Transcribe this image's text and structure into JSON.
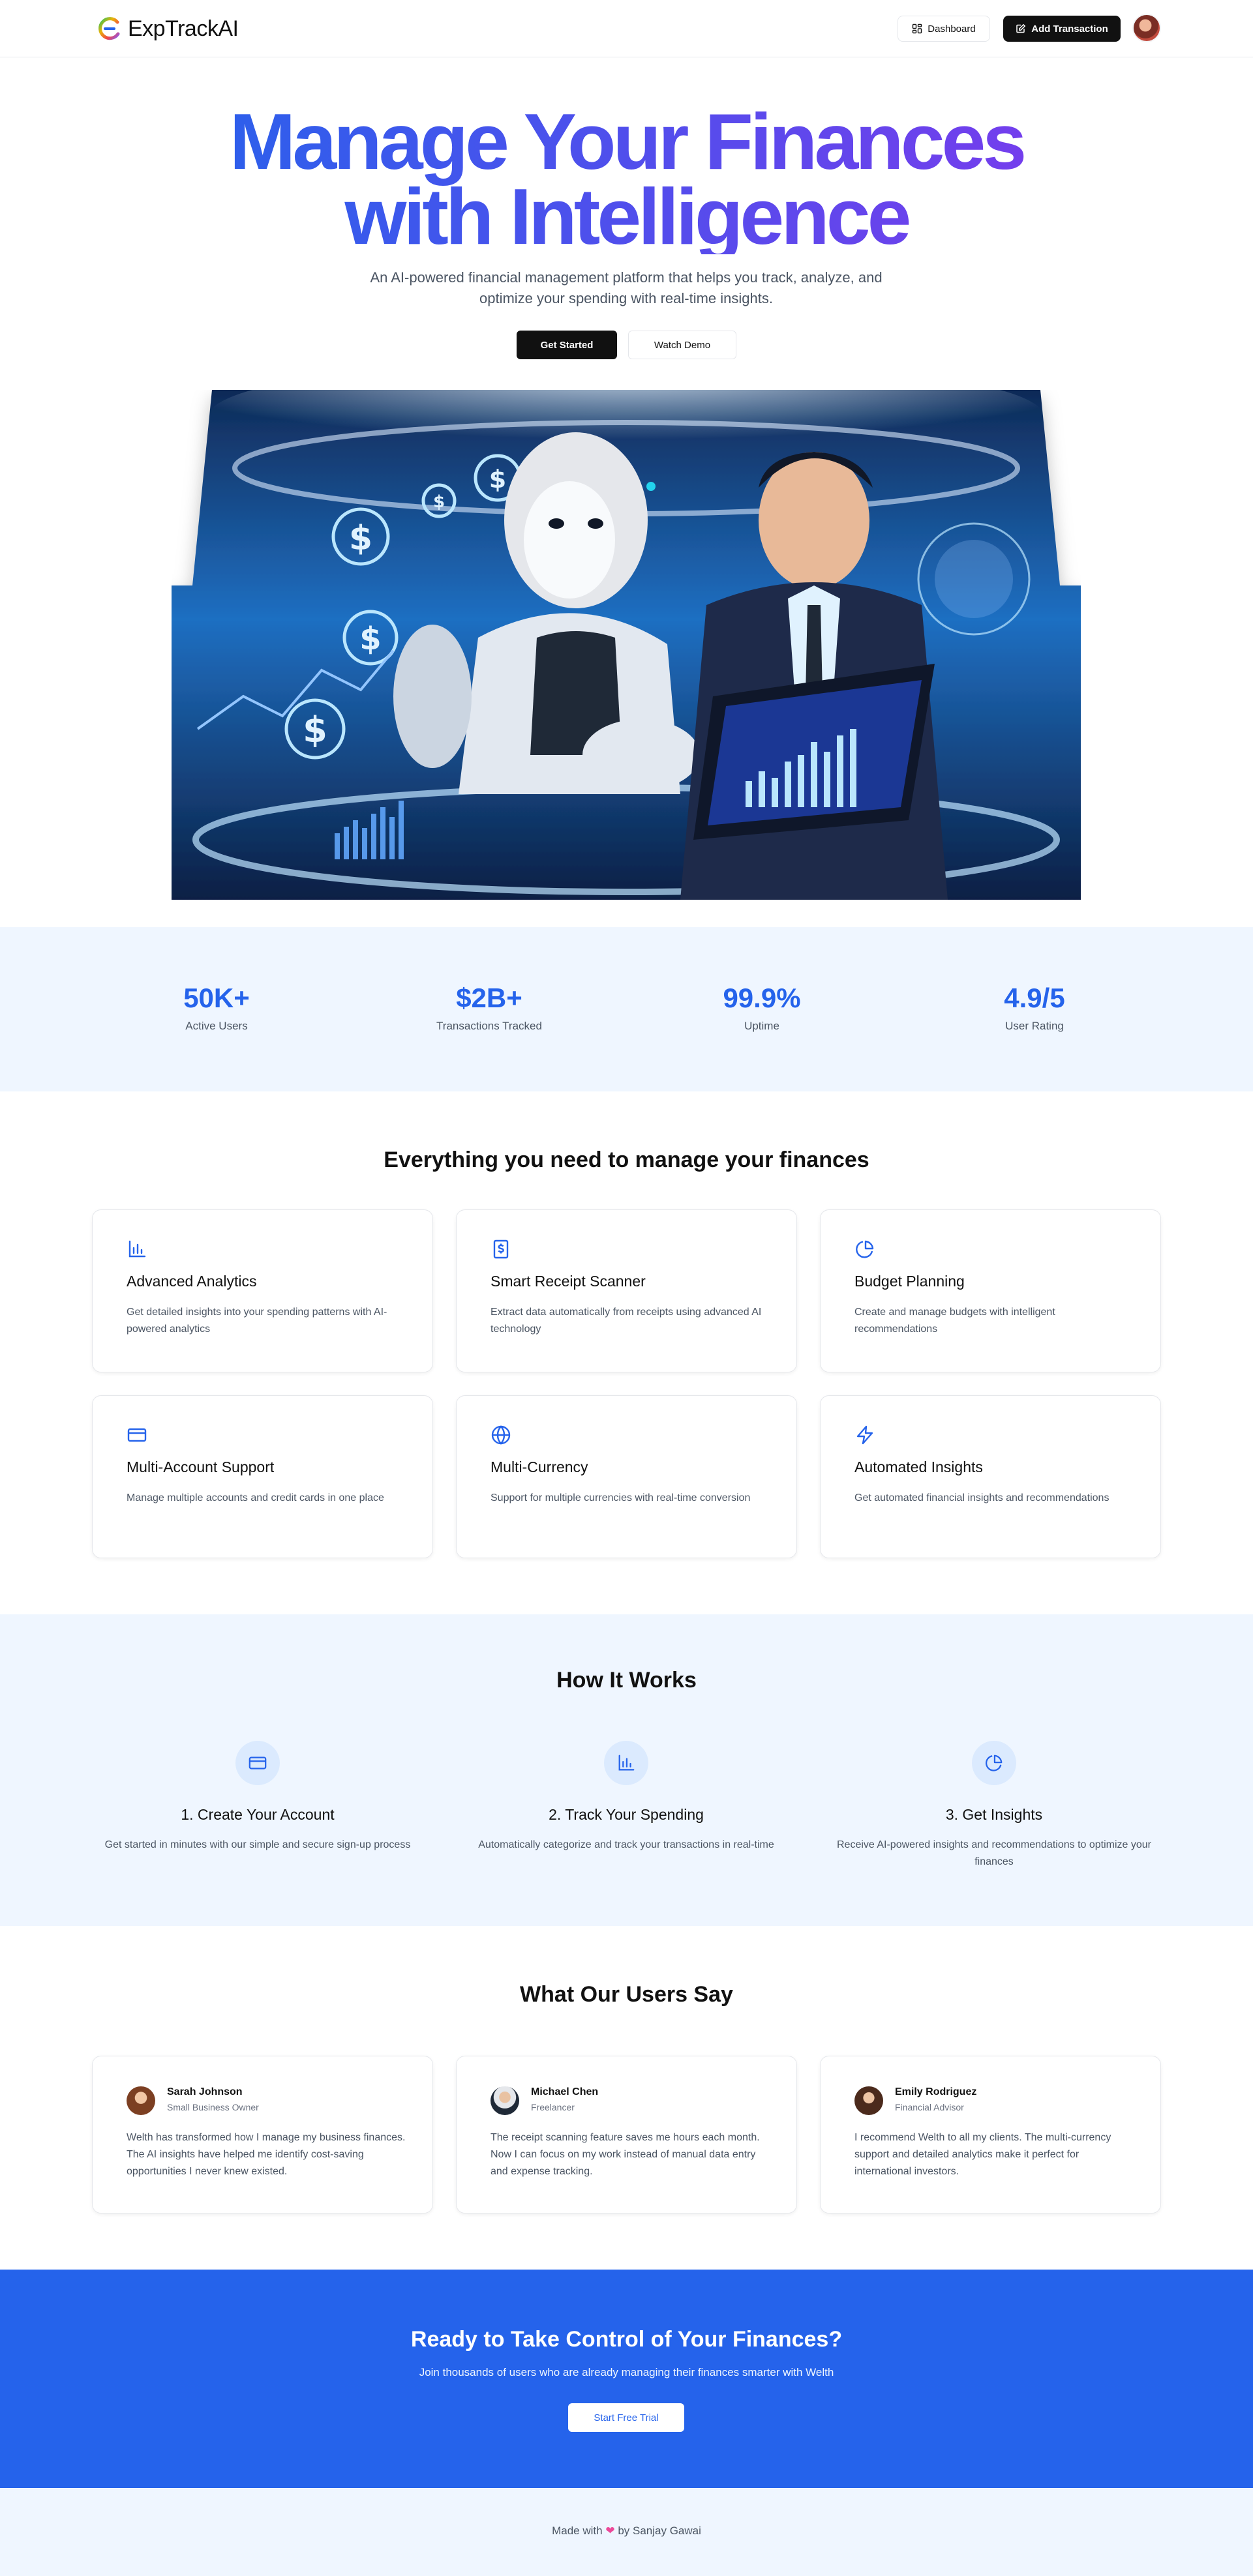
{
  "header": {
    "brand": "ExpTrackAI",
    "dashboard_label": "Dashboard",
    "add_transaction_label": "Add Transaction"
  },
  "hero": {
    "title_line1": "Manage Your Finances",
    "title_line2": "with Intelligence",
    "subtitle": "An AI-powered financial management platform that helps you track, analyze, and optimize your spending with real-time insights.",
    "primary_cta": "Get Started",
    "secondary_cta": "Watch Demo",
    "colors": {
      "gradient_start": "#2563eb",
      "gradient_end": "#7c3aed"
    }
  },
  "stats": [
    {
      "value": "50K+",
      "label": "Active Users"
    },
    {
      "value": "$2B+",
      "label": "Transactions Tracked"
    },
    {
      "value": "99.9%",
      "label": "Uptime"
    },
    {
      "value": "4.9/5",
      "label": "User Rating"
    }
  ],
  "features": {
    "title": "Everything you need to manage your finances",
    "items": [
      {
        "icon": "bar-chart-icon",
        "title": "Advanced Analytics",
        "description": "Get detailed insights into your spending patterns with AI-powered analytics"
      },
      {
        "icon": "receipt-icon",
        "title": "Smart Receipt Scanner",
        "description": "Extract data automatically from receipts using advanced AI technology"
      },
      {
        "icon": "pie-chart-icon",
        "title": "Budget Planning",
        "description": "Create and manage budgets with intelligent recommendations"
      },
      {
        "icon": "credit-card-icon",
        "title": "Multi-Account Support",
        "description": "Manage multiple accounts and credit cards in one place"
      },
      {
        "icon": "globe-icon",
        "title": "Multi-Currency",
        "description": "Support for multiple currencies with real-time conversion"
      },
      {
        "icon": "zap-icon",
        "title": "Automated Insights",
        "description": "Get automated financial insights and recommendations"
      }
    ]
  },
  "how_it_works": {
    "title": "How It Works",
    "steps": [
      {
        "icon": "credit-card-icon",
        "title": "1. Create Your Account",
        "description": "Get started in minutes with our simple and secure sign-up process"
      },
      {
        "icon": "bar-chart-icon",
        "title": "2. Track Your Spending",
        "description": "Automatically categorize and track your transactions in real-time"
      },
      {
        "icon": "pie-chart-icon",
        "title": "3. Get Insights",
        "description": "Receive AI-powered insights and recommendations to optimize your finances"
      }
    ]
  },
  "testimonials": {
    "title": "What Our Users Say",
    "items": [
      {
        "name": "Sarah Johnson",
        "role": "Small Business Owner",
        "quote": "Welth has transformed how I manage my business finances. The AI insights have helped me identify cost-saving opportunities I never knew existed."
      },
      {
        "name": "Michael Chen",
        "role": "Freelancer",
        "quote": "The receipt scanning feature saves me hours each month. Now I can focus on my work instead of manual data entry and expense tracking."
      },
      {
        "name": "Emily Rodriguez",
        "role": "Financial Advisor",
        "quote": "I recommend Welth to all my clients. The multi-currency support and detailed analytics make it perfect for international investors."
      }
    ]
  },
  "cta": {
    "title": "Ready to Take Control of Your Finances?",
    "subtitle": "Join thousands of users who are already managing their finances smarter with Welth",
    "button": "Start Free Trial"
  },
  "footer": {
    "made_with": "Made with",
    "by": "by Sanjay Gawai"
  },
  "theme": {
    "accent": "#2563eb",
    "soft_bg": "#eff6ff",
    "dark": "#111111"
  }
}
